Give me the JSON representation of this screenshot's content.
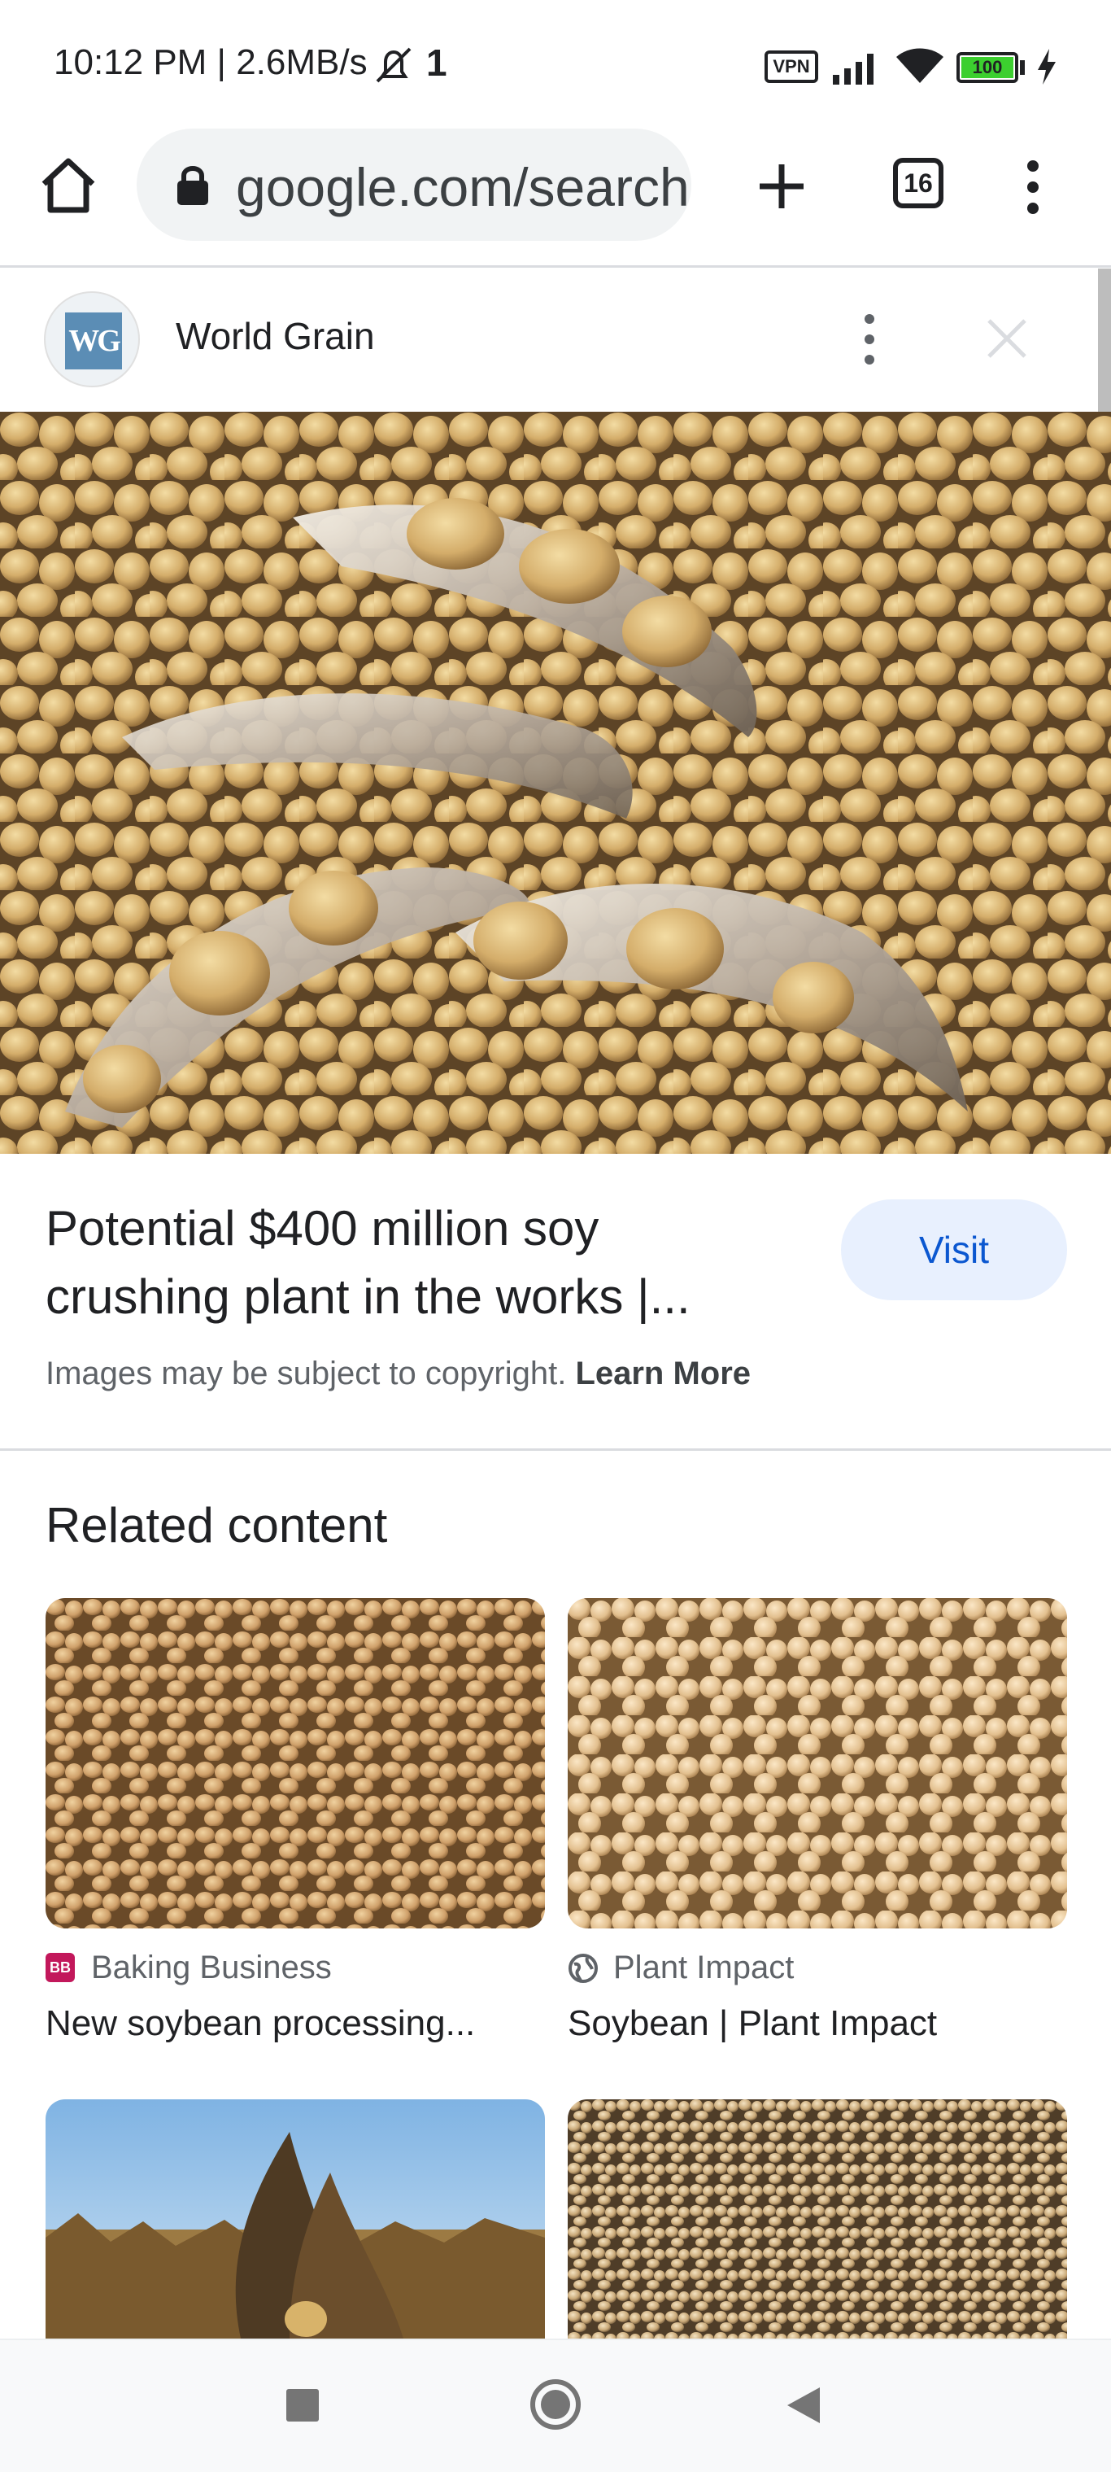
{
  "status_bar": {
    "time": "10:12 PM | 2.6MB/s",
    "vpn_label": "VPN",
    "battery": "100",
    "icons": [
      "mute-bell-icon",
      "signal-icon",
      "wifi-icon",
      "battery-icon",
      "charging-icon"
    ]
  },
  "browser": {
    "url": "google.com/search",
    "tab_count": "16",
    "icons": [
      "home-icon",
      "lock-icon",
      "new-tab-plus-icon",
      "tabs-icon",
      "menu-dots-icon"
    ]
  },
  "source": {
    "logo_text": "WG",
    "name": "World Grain"
  },
  "result": {
    "title_line1": "Potential $400 million soy",
    "title_line2": "crushing plant in the works |...",
    "visit_label": "Visit",
    "copyright_text": "Images may be subject to copyright.",
    "learn_more": "Learn More"
  },
  "related": {
    "heading": "Related content",
    "cards": [
      {
        "source": "Baking Business",
        "badge": "BB",
        "title": "New soybean processing..."
      },
      {
        "source": "Plant Impact",
        "title": "Soybean | Plant Impact"
      }
    ]
  },
  "colors": {
    "accent": "#0b57d0",
    "visit_bg": "#e8f0fe",
    "bb_badge": "#c2185b",
    "wg_logo": "#5b8db5"
  }
}
